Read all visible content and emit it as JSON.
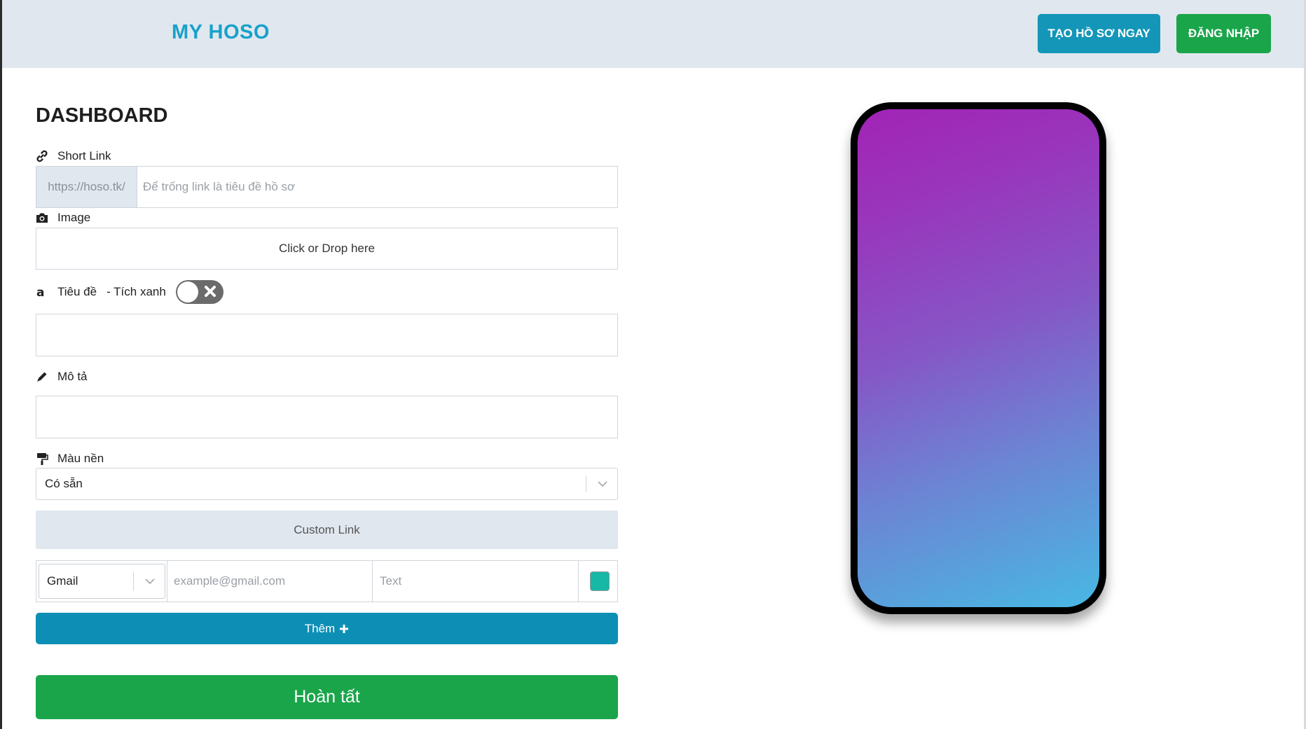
{
  "header": {
    "brand": "MY HOSO",
    "create_button": "TẠO HỒ SƠ NGAY",
    "login_button": "ĐĂNG NHẬP"
  },
  "dashboard": {
    "title": "DASHBOARD",
    "short_link": {
      "label": "Short Link",
      "prefix": "https://hoso.tk/",
      "placeholder": "Để trống link là tiêu đề hồ sơ"
    },
    "image": {
      "label": "Image",
      "dropzone": "Click or Drop here"
    },
    "title_field": {
      "label": "Tiêu đề",
      "verified_label": "- Tích xanh",
      "verified_on": false,
      "value": ""
    },
    "description": {
      "label": "Mô tả",
      "value": ""
    },
    "background": {
      "label": "Màu nền",
      "selected": "Có sẵn"
    },
    "custom_link": {
      "header": "Custom Link",
      "type_selected": "Gmail",
      "value_placeholder": "example@gmail.com",
      "text_placeholder": "Text",
      "color": "#17b8a6"
    },
    "add_button": "Thêm",
    "done_button": "Hoàn tất"
  },
  "preview": {
    "gradient_start": "#a224b6",
    "gradient_end": "#48b8e3"
  },
  "colors": {
    "brand": "#17a2c9",
    "primary": "#1396b8",
    "success": "#1aa54a",
    "header_bg": "#e1e7ef"
  }
}
